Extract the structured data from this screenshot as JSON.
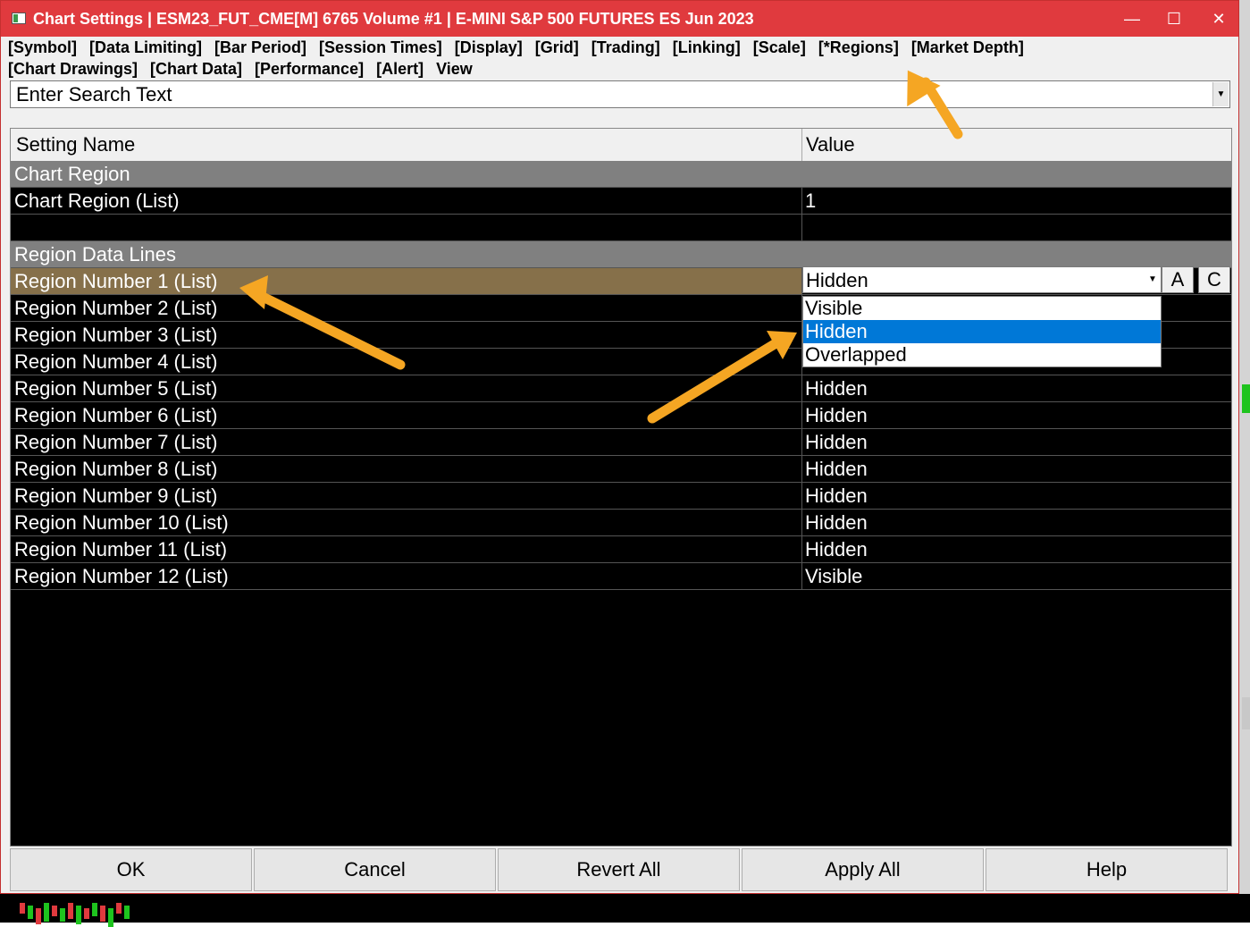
{
  "window": {
    "title": "Chart Settings | ESM23_FUT_CME[M]  6765 Volume  #1 | E-MINI S&P 500 FUTURES ES Jun 2023",
    "minimize": "—",
    "maximize": "☐",
    "close": "✕"
  },
  "menu_row1": [
    "[Symbol]",
    "[Data Limiting]",
    "[Bar Period]",
    "[Session Times]",
    "[Display]",
    "[Grid]",
    "[Trading]",
    "[Linking]",
    "[Scale]",
    "[*Regions]",
    "[Market Depth]"
  ],
  "menu_row2": [
    "[Chart Drawings]",
    "[Chart Data]",
    "[Performance]",
    "[Alert]",
    "View"
  ],
  "search": {
    "placeholder": "Enter Search Text"
  },
  "table": {
    "col_setting": "Setting Name",
    "col_value": "Value",
    "rows": [
      {
        "type": "section",
        "name": "Chart Region",
        "value": ""
      },
      {
        "type": "row",
        "name": "Chart Region (List)",
        "value": "1"
      },
      {
        "type": "blank",
        "name": "",
        "value": ""
      },
      {
        "type": "section",
        "name": "Region Data Lines",
        "value": ""
      },
      {
        "type": "selected",
        "name": "Region Number 1 (List)",
        "value": "Hidden"
      },
      {
        "type": "row",
        "name": "Region Number 2 (List)",
        "value": ""
      },
      {
        "type": "row",
        "name": "Region Number 3 (List)",
        "value": ""
      },
      {
        "type": "row",
        "name": "Region Number 4 (List)",
        "value": ""
      },
      {
        "type": "row",
        "name": "Region Number 5 (List)",
        "value": "Hidden"
      },
      {
        "type": "row",
        "name": "Region Number 6 (List)",
        "value": "Hidden"
      },
      {
        "type": "row",
        "name": "Region Number 7 (List)",
        "value": "Hidden"
      },
      {
        "type": "row",
        "name": "Region Number 8 (List)",
        "value": "Hidden"
      },
      {
        "type": "row",
        "name": "Region Number 9 (List)",
        "value": "Hidden"
      },
      {
        "type": "row",
        "name": "Region Number 10 (List)",
        "value": "Hidden"
      },
      {
        "type": "row",
        "name": "Region Number 11 (List)",
        "value": "Hidden"
      },
      {
        "type": "row",
        "name": "Region Number 12 (List)",
        "value": "Visible"
      }
    ]
  },
  "combo": {
    "value": "Hidden",
    "btn_a": "A",
    "btn_c": "C"
  },
  "dropdown": {
    "options": [
      "Visible",
      "Hidden",
      "Overlapped"
    ],
    "selected": "Hidden"
  },
  "footer": {
    "buttons": [
      "OK",
      "Cancel",
      "Revert All",
      "Apply All",
      "Help"
    ]
  },
  "colors": {
    "titlebar": "#e03a3e",
    "section_bg": "#808080",
    "selected_row": "#86704a",
    "highlight": "#0078d7",
    "arrow": "#f5a623"
  }
}
